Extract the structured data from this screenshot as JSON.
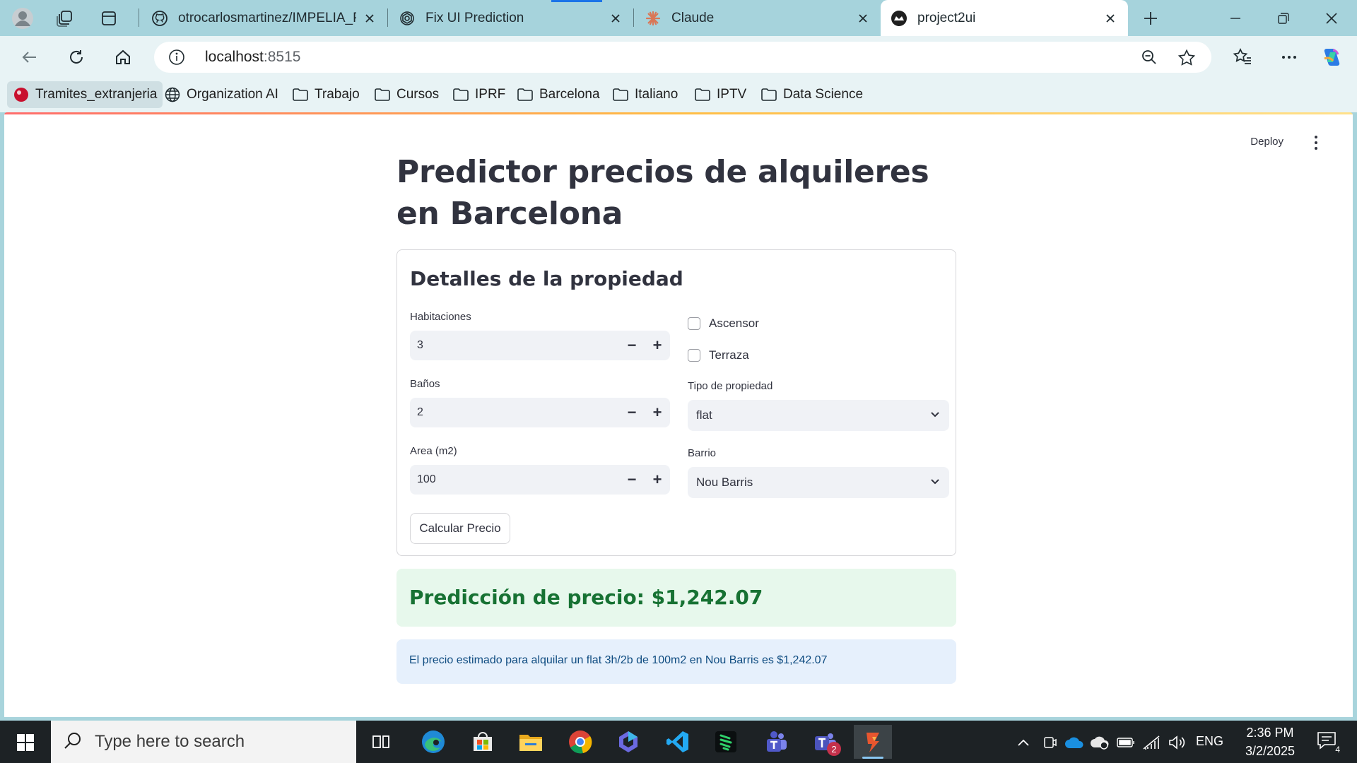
{
  "browser": {
    "tabs": [
      {
        "title": "otrocarlosmartinez/IMPELIA_PEA",
        "icon": "github-icon"
      },
      {
        "title": "Fix UI Prediction",
        "icon": "openai-icon"
      },
      {
        "title": "Claude",
        "icon": "claude-icon"
      },
      {
        "title": "project2ui",
        "icon": "streamlit-icon",
        "active": true
      }
    ],
    "address": {
      "host": "localhost",
      "port": ":8515"
    },
    "bookmarks": [
      {
        "label": "Tramites_extranjeria",
        "icon": "site-icon"
      },
      {
        "label": "Organization AI",
        "icon": "globe-icon"
      },
      {
        "label": "Trabajo",
        "icon": "folder-icon"
      },
      {
        "label": "Cursos",
        "icon": "folder-icon"
      },
      {
        "label": "IPRF",
        "icon": "folder-icon"
      },
      {
        "label": "Barcelona",
        "icon": "folder-icon"
      },
      {
        "label": "Italiano",
        "icon": "folder-icon"
      },
      {
        "label": "IPTV",
        "icon": "folder-icon"
      },
      {
        "label": "Data Science",
        "icon": "folder-icon"
      }
    ]
  },
  "app": {
    "deploy_label": "Deploy",
    "title": "Predictor precios de alquileres en Barcelona",
    "form": {
      "header": "Detalles de la propiedad",
      "habitaciones": {
        "label": "Habitaciones",
        "value": "3"
      },
      "banos": {
        "label": "Baños",
        "value": "2"
      },
      "area": {
        "label": "Area (m2)",
        "value": "100"
      },
      "ascensor": {
        "label": "Ascensor",
        "checked": false
      },
      "terraza": {
        "label": "Terraza",
        "checked": false
      },
      "tipo": {
        "label": "Tipo de propiedad",
        "value": "flat"
      },
      "barrio": {
        "label": "Barrio",
        "value": "Nou Barris"
      },
      "submit_label": "Calcular Precio",
      "minus": "−",
      "plus": "+"
    },
    "result": {
      "success_text": "Predicción de precio: $1,242.07",
      "info_text": "El precio estimado para alquilar un flat 3h/2b de 100m2 en Nou Barris es $1,242.07"
    }
  },
  "taskbar": {
    "search_placeholder": "Type here to search",
    "language": "ENG",
    "time": "2:36 PM",
    "date": "3/2/2025",
    "teams_badge": "2",
    "notification_count": "4"
  },
  "colors": {
    "accent_green": "#177233",
    "success_bg": "#e7f8ec",
    "info_bg": "#e6f0fc",
    "info_text": "#0f4c81",
    "tabbar_bg": "#a6d3dc"
  }
}
